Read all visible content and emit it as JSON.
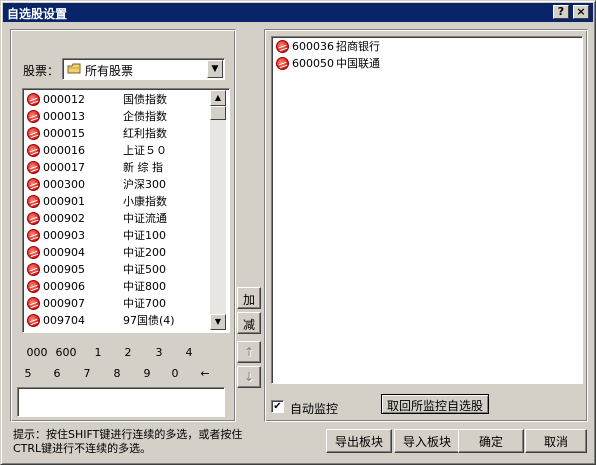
{
  "window": {
    "title": "自选股设置",
    "help_label": "?",
    "close_label": "×"
  },
  "filter": {
    "label": "股票：",
    "selected": "所有股票",
    "arrow": "▼"
  },
  "stock_list": [
    {
      "code": "000012",
      "name": "国债指数"
    },
    {
      "code": "000013",
      "name": "企债指数"
    },
    {
      "code": "000015",
      "name": "红利指数"
    },
    {
      "code": "000016",
      "name": "上证５０"
    },
    {
      "code": "000017",
      "name": "新 综 指"
    },
    {
      "code": "000300",
      "name": "沪深300"
    },
    {
      "code": "000901",
      "name": "小康指数"
    },
    {
      "code": "000902",
      "name": "中证流通"
    },
    {
      "code": "000903",
      "name": "中证100"
    },
    {
      "code": "000904",
      "name": "中证200"
    },
    {
      "code": "000905",
      "name": "中证500"
    },
    {
      "code": "000906",
      "name": "中证800"
    },
    {
      "code": "000907",
      "name": "中证700"
    },
    {
      "code": "009704",
      "name": "97国债(4)"
    }
  ],
  "scroll": {
    "up": "▲",
    "down": "▼"
  },
  "keypad": {
    "row1": [
      "000",
      "600",
      "1",
      "2",
      "3",
      "4"
    ],
    "row2": [
      "5",
      "6",
      "7",
      "8",
      "9",
      "0",
      "←"
    ]
  },
  "code_input": {
    "value": ""
  },
  "middle_buttons": {
    "add": "加",
    "remove": "减",
    "up": "↑",
    "down": "↓"
  },
  "selected_list": [
    {
      "code": "600036",
      "name": "招商银行"
    },
    {
      "code": "600050",
      "name": "中国联通"
    }
  ],
  "auto_monitor": {
    "label": "自动监控",
    "checked": true,
    "check_glyph": "✔"
  },
  "reset_button": "取回所监控自选股",
  "hint": {
    "line1": "提示：按住SHIFT键进行连续的多选，或者按住",
    "line2": "CTRL键进行不连续的多选。"
  },
  "footer": {
    "export": "导出板块",
    "import": "导入板块",
    "ok": "确定",
    "cancel": "取消"
  }
}
